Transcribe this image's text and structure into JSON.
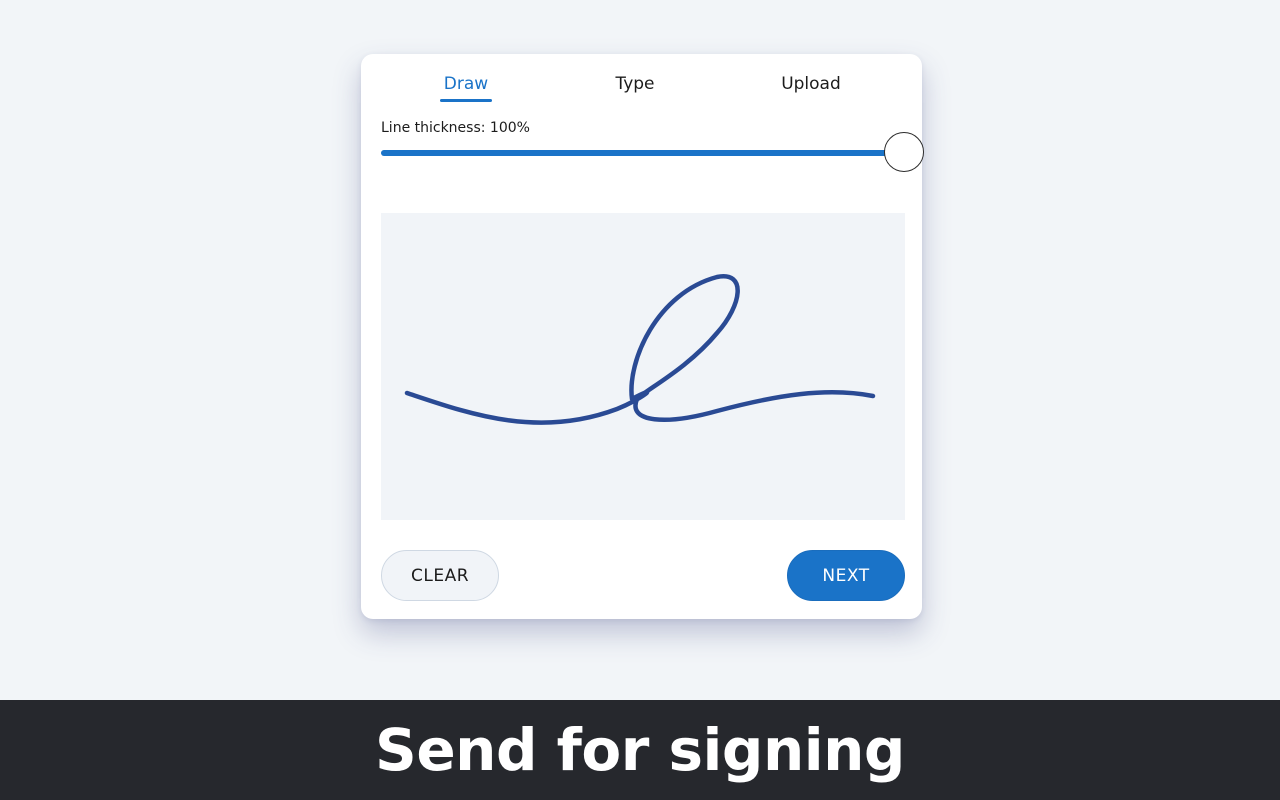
{
  "tabs": [
    {
      "label": "Draw",
      "active": true
    },
    {
      "label": "Type",
      "active": false
    },
    {
      "label": "Upload",
      "active": false
    }
  ],
  "line_thickness": {
    "label": "Line thickness: 100%",
    "value_percent": 100
  },
  "buttons": {
    "clear_label": "CLEAR",
    "next_label": "NEXT"
  },
  "signature": {
    "stroke_color": "#2a4a94"
  },
  "colors": {
    "accent": "#1a73c8",
    "banner_bg": "#26282d",
    "page_bg": "#f2f5f8"
  },
  "banner": {
    "text": "Send for signing"
  }
}
